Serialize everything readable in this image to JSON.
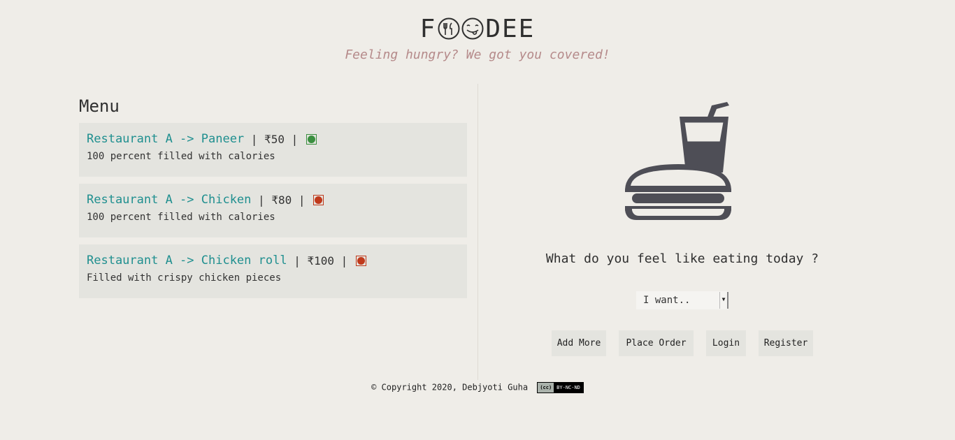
{
  "header": {
    "logo_prefix": "F",
    "logo_suffix": "DEE",
    "tagline": "Feeling hungry? We got you covered!"
  },
  "menu": {
    "title": "Menu",
    "items": [
      {
        "name": "Restaurant A -> Paneer",
        "price": "₹50",
        "type": "veg",
        "description": "100 percent filled with calories"
      },
      {
        "name": "Restaurant A -> Chicken",
        "price": "₹80",
        "type": "non-veg",
        "description": "100 percent filled with calories"
      },
      {
        "name": "Restaurant A -> Chicken roll",
        "price": "₹100",
        "type": "non-veg",
        "description": "Filled with crispy chicken pieces"
      }
    ]
  },
  "order": {
    "question": "What do you feel like eating today ?",
    "select_value": "I want..",
    "buttons": {
      "add_more": "Add More",
      "place_order": "Place Order",
      "login": "Login",
      "register": "Register"
    }
  },
  "footer": {
    "copyright": "© Copyright 2020, Debjyoti Guha",
    "license_cc": "(cc)",
    "license_text": "BY-NC-ND"
  },
  "colors": {
    "veg": "#3a8f3f",
    "non_veg": "#c0391b",
    "accent": "#1f8f8f",
    "tagline": "#b58a8a",
    "illustration": "#4e4e56"
  }
}
